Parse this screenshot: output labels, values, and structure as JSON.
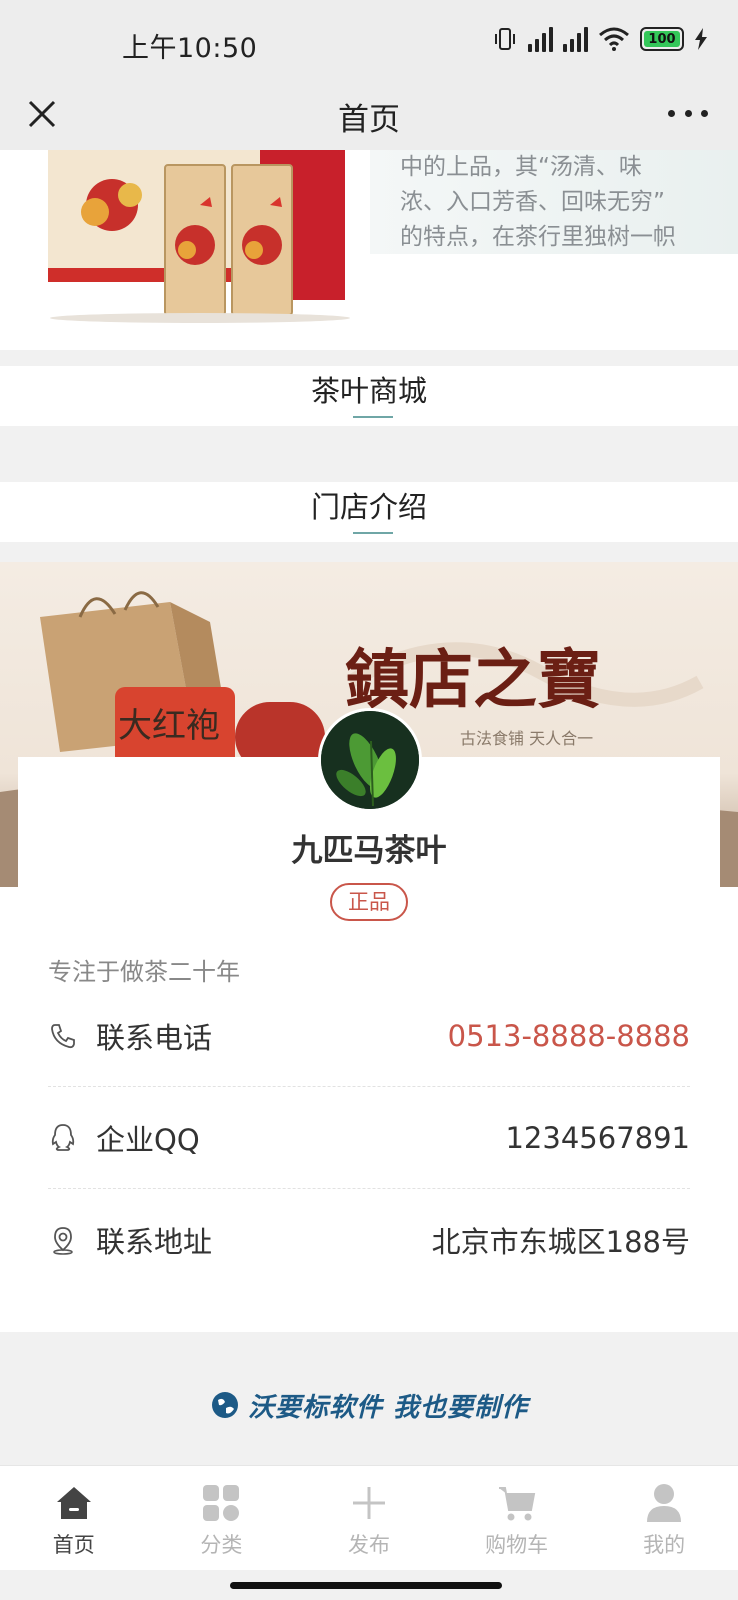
{
  "status_bar": {
    "time": "上午10:50",
    "battery": "100"
  },
  "nav": {
    "title": "首页",
    "close_icon": "close-icon",
    "more_icon": "more-dots-icon"
  },
  "promo": {
    "lines": [
      "中的上品，其“汤清、味",
      "浓、入口芳香、回味无穷”",
      "的特点，在茶行里独树一帜"
    ]
  },
  "sections": {
    "shop": "茶叶商城",
    "store_intro": "门店介绍"
  },
  "store": {
    "name": "九匹马茶叶",
    "badge": "正品",
    "tagline": "专注于做茶二十年",
    "rows": [
      {
        "key": "联系电话",
        "value": "0513-8888-8888",
        "icon": "phone-icon"
      },
      {
        "key": "企业QQ",
        "value": "1234567891",
        "icon": "qq-icon"
      },
      {
        "key": "联系地址",
        "value": "北京市东城区188号",
        "icon": "location-icon"
      }
    ]
  },
  "footer": {
    "brand": "沃要标软件 我也要制作"
  },
  "tabs": [
    {
      "label": "首页",
      "icon": "home-icon",
      "active": true
    },
    {
      "label": "分类",
      "icon": "category-grid-icon",
      "active": false
    },
    {
      "label": "发布",
      "icon": "plus-icon",
      "active": false
    },
    {
      "label": "购物车",
      "icon": "cart-icon",
      "active": false
    },
    {
      "label": "我的",
      "icon": "user-icon",
      "active": false
    }
  ],
  "colors": {
    "accent_red": "#c9564a",
    "teal_underline": "#6fa6a6",
    "brand_blue": "#1d5a86"
  }
}
